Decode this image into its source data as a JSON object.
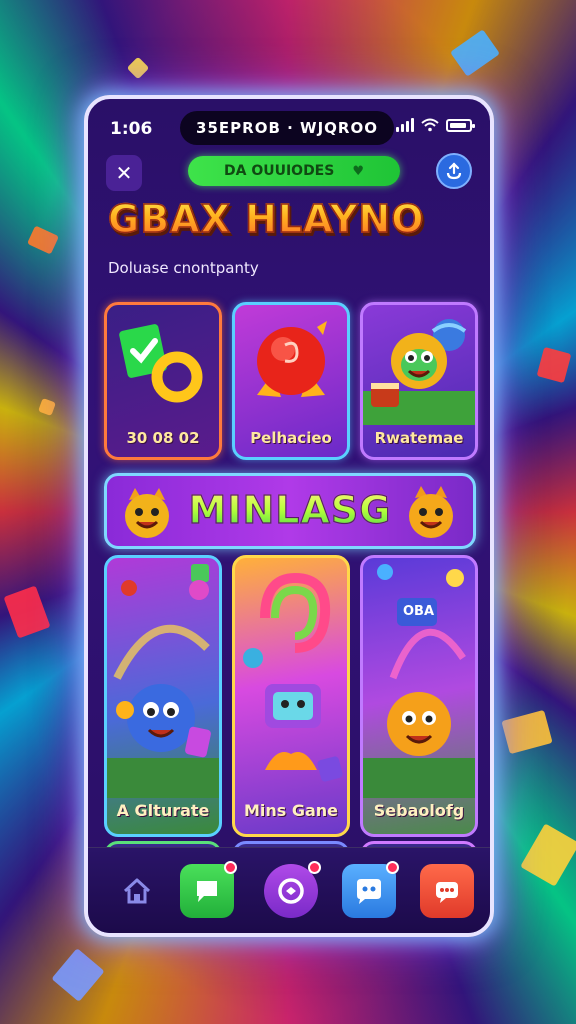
{
  "status": {
    "time": "1:06",
    "center_text": "35EPROB · WJQROO"
  },
  "header": {
    "pill_label": "DA OUUIODES",
    "title": "GBAX HLAYNO",
    "subtitle": "Doluase cnontpanty"
  },
  "top_cards": [
    {
      "label": "30 08 02"
    },
    {
      "label": "Pelhacieo"
    },
    {
      "label": "Rwatemae"
    }
  ],
  "banner": {
    "label": "MINLASG"
  },
  "game_cards": [
    {
      "label": "A Glturate"
    },
    {
      "label": "Mins Gane"
    },
    {
      "label": "Sebaolofg"
    }
  ],
  "card3_sign": "OBA",
  "nav": {
    "items": [
      "home",
      "chat",
      "game",
      "face",
      "messages"
    ]
  },
  "colors": {
    "accent_green": "#3ee34a",
    "frame_glow": "#7fd8ff",
    "title_gold": "#ffb11f"
  }
}
